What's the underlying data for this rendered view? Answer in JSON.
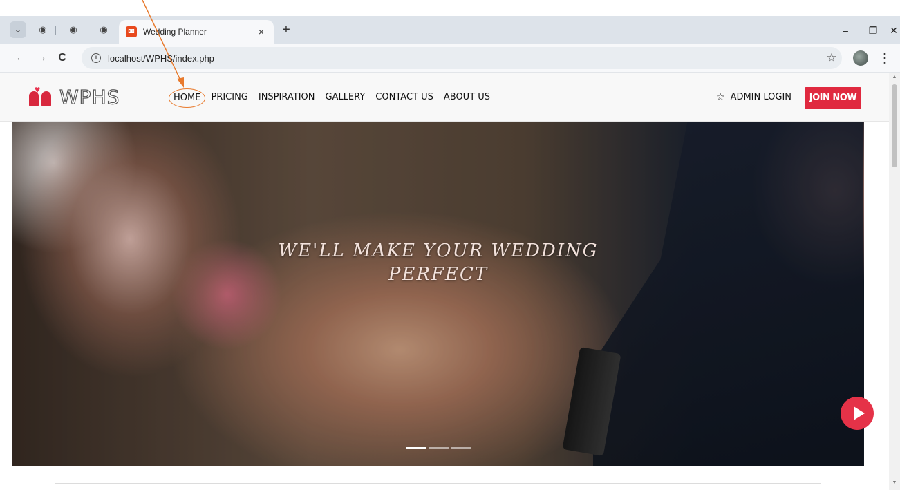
{
  "browser": {
    "tab_title": "Wedding Planner",
    "tab_close": "×",
    "new_tab": "+",
    "url": "localhost/WPHS/index.php",
    "win_minimize": "–",
    "win_restore": "❐",
    "win_close": "✕"
  },
  "site": {
    "logo_text": "WPHS",
    "nav": [
      {
        "label": "HOME"
      },
      {
        "label": "PRICING"
      },
      {
        "label": "INSPIRATION"
      },
      {
        "label": "GALLERY"
      },
      {
        "label": "CONTACT US"
      },
      {
        "label": "ABOUT US"
      }
    ],
    "admin_login": "ADMIN LOGIN",
    "join_now": "JOIN NOW"
  },
  "hero": {
    "headline_line1": "WE'LL MAKE YOUR WEDDING",
    "headline_line2": "PERFECT",
    "slide_count": 3,
    "active_slide": 1
  },
  "colors": {
    "brand_red": "#e0293f",
    "annotation_orange": "#e87a2d",
    "tabstrip": "#dde3ea"
  },
  "icons": [
    "tab-search-icon",
    "tab-group-icon",
    "favicon-icon",
    "back-icon",
    "forward-icon",
    "reload-icon",
    "site-info-icon",
    "bookmark-star-icon",
    "profile-icon",
    "menu-kebab-icon",
    "logo-couple-icon",
    "star-icon",
    "play-icon"
  ]
}
